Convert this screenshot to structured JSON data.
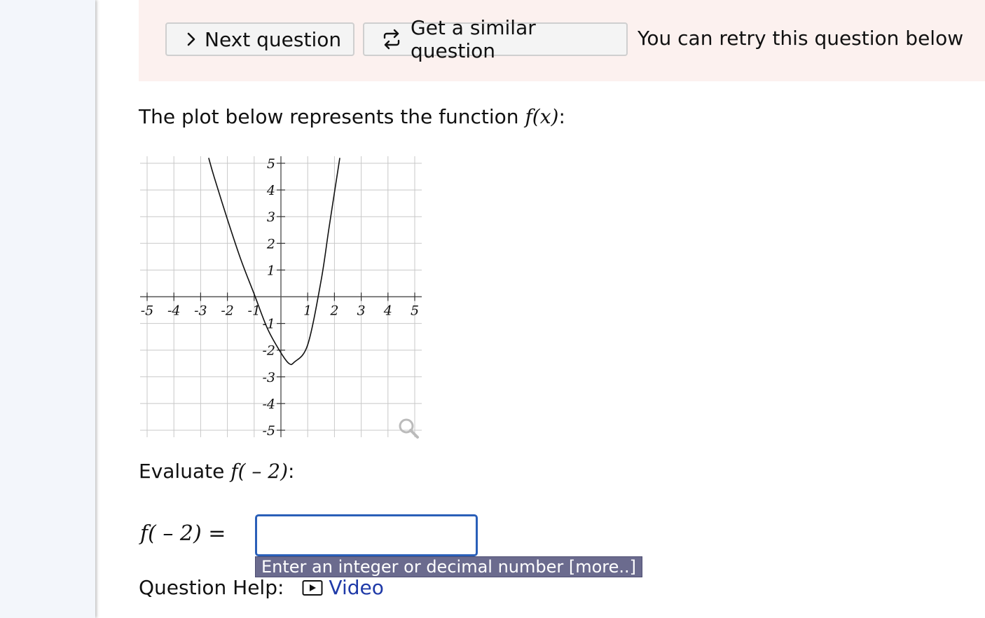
{
  "banner": {
    "next_question_label": "Next question",
    "similar_question_label": "Get a similar question",
    "retry_text": "You can retry this question below"
  },
  "question": {
    "prompt_text": "The plot below represents the function ",
    "prompt_math": "f(x)",
    "prompt_suffix": ":",
    "evaluate_text": "Evaluate ",
    "evaluate_math": "f( – 2)",
    "evaluate_suffix": ":"
  },
  "answer": {
    "label_math": "f( – 2) =",
    "value": "",
    "hint": "Enter an integer or decimal number [more..]"
  },
  "help": {
    "label": "Question Help:",
    "video_label": "Video"
  },
  "icons": {
    "next": "chevron-right-icon",
    "similar": "repeat-icon",
    "magnifier": "magnifier-icon",
    "video": "play-icon"
  },
  "colors": {
    "banner_bg": "#fcf1ef",
    "input_border": "#2a5fb8",
    "hint_bg": "#6b6b8e",
    "link": "#1f3aa8"
  },
  "chart_data": {
    "type": "line",
    "xlim": [
      -5,
      5
    ],
    "ylim": [
      -5,
      5
    ],
    "grid": true,
    "x_ticks": [
      "-5",
      "-4",
      "-3",
      "-2",
      "-1",
      "1",
      "2",
      "3",
      "4",
      "5"
    ],
    "y_ticks": [
      "5",
      "4",
      "3",
      "2",
      "1",
      "-1",
      "-2",
      "-3",
      "-4",
      "-5"
    ],
    "series": [
      {
        "x": [
          -2.7,
          -2.5,
          -2,
          -1.5,
          -1,
          -0.5,
          0,
          0.3,
          0.5,
          1,
          1.5,
          1.8,
          2.2
        ],
        "y": [
          5.2,
          4.5,
          2.9,
          1.4,
          0.1,
          -1.2,
          -2.1,
          -2.5,
          -2.45,
          -1.8,
          0.6,
          2.6,
          5.2
        ]
      }
    ]
  }
}
